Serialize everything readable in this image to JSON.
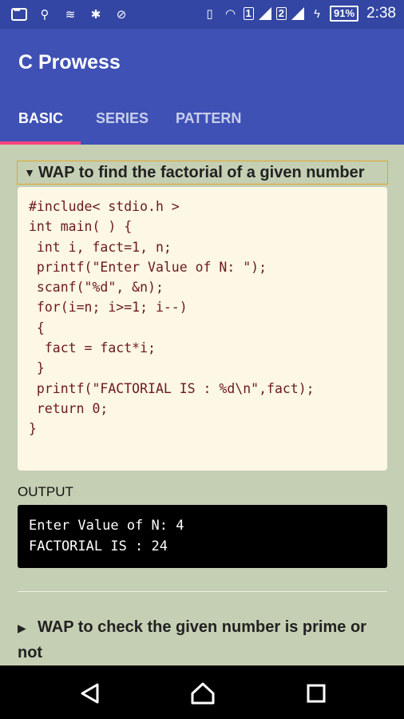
{
  "status_bar": {
    "battery": "91%",
    "time": "2:38",
    "sim1": "1",
    "sim2": "2"
  },
  "app": {
    "title": "C Prowess"
  },
  "tabs": [
    {
      "label": "BASIC",
      "active": true
    },
    {
      "label": "SERIES",
      "active": false
    },
    {
      "label": "PATTERN",
      "active": false
    }
  ],
  "question1": {
    "title": "WAP to find the factorial of a given number",
    "code": [
      "#include< stdio.h >",
      "int main( ) {",
      " int i, fact=1, n;",
      " printf(\"Enter Value of N: \");",
      " scanf(\"%d\", &n);",
      " for(i=n; i>=1; i--)",
      " {",
      "  fact = fact*i;",
      " }",
      " printf(\"FACTORIAL IS : %d\\n\",fact);",
      " return 0;",
      "}"
    ],
    "output_label": "OUTPUT",
    "output": [
      "Enter Value of N: 4",
      "FACTORIAL IS : 24"
    ]
  },
  "question2": {
    "title": "WAP to check the given number is prime or not"
  },
  "colors": {
    "primary": "#3f51b5",
    "status_bar": "#3346a3",
    "accent": "#ff4081",
    "background": "#c5cfb3",
    "code_bg": "#fdf7e6",
    "code_text": "#6b1a1a"
  }
}
